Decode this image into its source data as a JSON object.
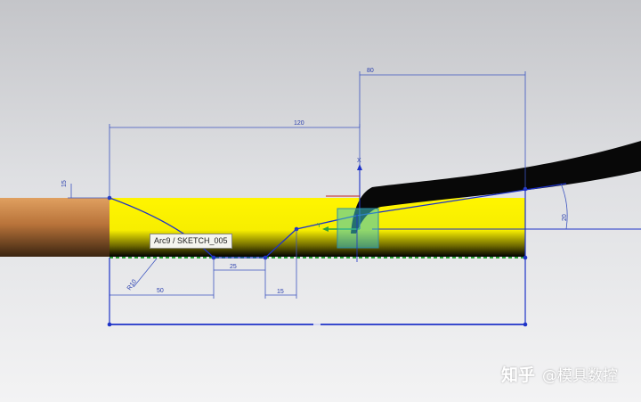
{
  "tooltip": {
    "text": "Arc9 / SKETCH_005"
  },
  "dimensions": {
    "top_length": "120",
    "right_length": "80",
    "left_height": "15",
    "bottom_length": "50",
    "valley_width": "25",
    "step_width": "15",
    "arc_radius": "R10",
    "angle": "20"
  },
  "axes": {
    "x_label": "X",
    "y_label": "Y"
  },
  "watermark": {
    "brand": "知乎",
    "author": "@模具数控"
  },
  "colors": {
    "body_fill": "#fff500",
    "sketch_line": "#1e33c8",
    "dimension_line": "#3d55c0",
    "handle_fill": "#3dc4c4",
    "copper": "#c07a3c",
    "blade": "#080808"
  }
}
